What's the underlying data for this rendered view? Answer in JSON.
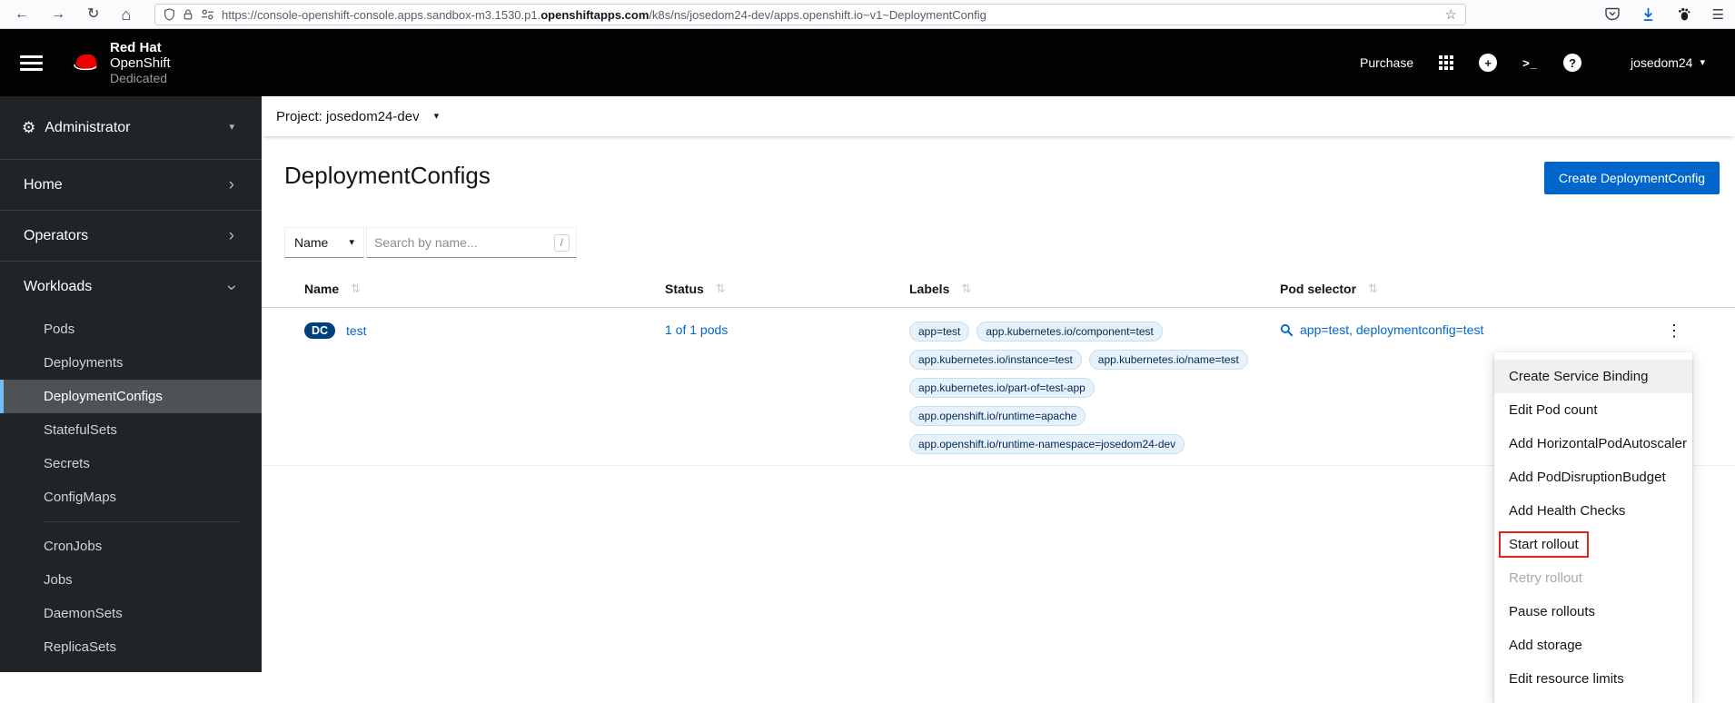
{
  "browser": {
    "url": {
      "prefix": "https://console-openshift-console.apps.sandbox-m3.1530.p1.",
      "domain_bold": "openshiftapps.com",
      "path": "/k8s/ns/josedom24-dev/apps.openshift.io~v1~DeploymentConfig"
    }
  },
  "masthead": {
    "brand": {
      "line1": "Red Hat",
      "line2": "OpenShift",
      "line3": "Dedicated"
    },
    "purchase_label": "Purchase",
    "username": "josedom24"
  },
  "sidebar": {
    "perspective_label": "Administrator",
    "home_label": "Home",
    "operators_label": "Operators",
    "workloads_label": "Workloads",
    "workloads_group1": [
      {
        "label": "Pods"
      },
      {
        "label": "Deployments"
      },
      {
        "label": "DeploymentConfigs",
        "state": "selected"
      },
      {
        "label": "StatefulSets"
      },
      {
        "label": "Secrets"
      },
      {
        "label": "ConfigMaps"
      }
    ],
    "workloads_group2": [
      {
        "label": "CronJobs"
      },
      {
        "label": "Jobs"
      },
      {
        "label": "DaemonSets"
      },
      {
        "label": "ReplicaSets"
      }
    ]
  },
  "project_bar": {
    "label": "Project: josedom24-dev"
  },
  "page": {
    "title": "DeploymentConfigs",
    "create_button_label": "Create DeploymentConfig"
  },
  "toolbar": {
    "filter_label": "Name",
    "search_placeholder": "Search by name...",
    "search_shortcut": "/"
  },
  "table": {
    "columns": [
      "Name",
      "Status",
      "Labels",
      "Pod selector"
    ],
    "row": {
      "badge": "DC",
      "name": "test",
      "status": "1 of 1 pods",
      "labels": [
        "app=test",
        "app.kubernetes.io/component=test",
        "app.kubernetes.io/instance=test",
        "app.kubernetes.io/name=test",
        "app.kubernetes.io/part-of=test-app",
        "app.openshift.io/runtime=apache",
        "app.openshift.io/runtime-namespace=josedom24-dev"
      ],
      "pod_selector": "app=test, deploymentconfig=test"
    }
  },
  "context_menu": {
    "items": [
      {
        "label": "Create Service Binding",
        "state": "hover"
      },
      {
        "label": "Edit Pod count"
      },
      {
        "label": "Add HorizontalPodAutoscaler"
      },
      {
        "label": "Add PodDisruptionBudget"
      },
      {
        "label": "Add Health Checks"
      },
      {
        "label": "Start rollout",
        "state": "annotated"
      },
      {
        "label": "Retry rollout",
        "state": "disabled"
      },
      {
        "label": "Pause rollouts"
      },
      {
        "label": "Add storage"
      },
      {
        "label": "Edit resource limits"
      }
    ]
  },
  "colors": {
    "accent_blue": "#0066cc",
    "link_blue": "#0066cc",
    "masthead_bg": "#030303",
    "sidebar_bg": "#212427",
    "sidebar_selected_bg": "#4f5255",
    "sidebar_selected_border": "#73bcf7",
    "redhat_red": "#ee0000",
    "annotation_red": "#e0251b",
    "label_chip_bg": "#e7f1fa",
    "label_chip_border": "#bee1f4",
    "label_chip_text": "#002952",
    "dc_badge_bg": "#004080",
    "download_icon_blue": "#0060df"
  }
}
